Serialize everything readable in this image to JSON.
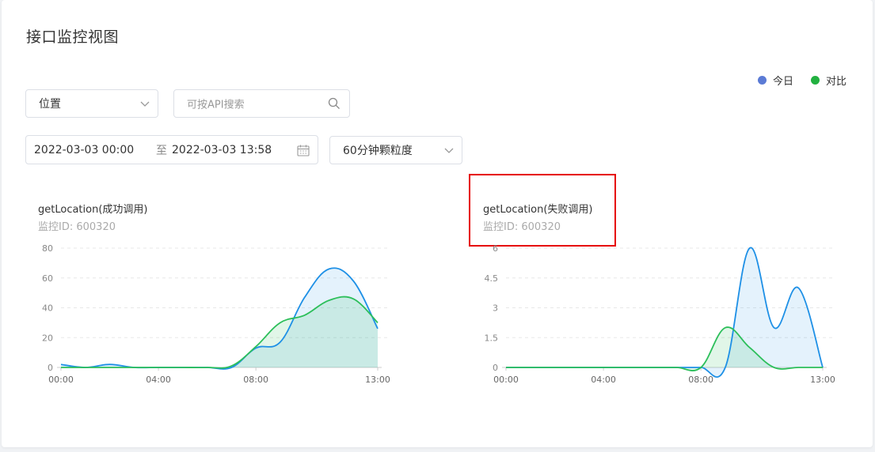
{
  "page": {
    "title": "接口监控视图"
  },
  "legend": [
    {
      "label": "今日",
      "color": "#5b7bd5"
    },
    {
      "label": "对比",
      "color": "#22b140"
    }
  ],
  "filters": {
    "type_select": "位置",
    "search_placeholder": "可按API搜索",
    "date_start": "2022-03-03 00:00",
    "date_sep": "至",
    "date_end": "2022-03-03 13:58",
    "granularity": "60分钟颗粒度"
  },
  "charts": [
    {
      "title": "getLocation(成功调用)",
      "subtitle": "监控ID: 600320"
    },
    {
      "title": "getLocation(失败调用)",
      "subtitle": "监控ID: 600320"
    }
  ],
  "chart_data": [
    {
      "type": "area",
      "title": "getLocation(成功调用)",
      "x_tick_labels": [
        "00:00",
        "04:00",
        "08:00",
        "13:00"
      ],
      "x": [
        0,
        1,
        2,
        3,
        4,
        5,
        6,
        7,
        8,
        9,
        10,
        11,
        12,
        13
      ],
      "ylim": [
        0,
        80
      ],
      "y_ticks": [
        0,
        20,
        40,
        60,
        80
      ],
      "grid": true,
      "series": [
        {
          "name": "今日",
          "color": "#1e90e6",
          "values": [
            2,
            0,
            2,
            0,
            0,
            0,
            0,
            0,
            13,
            17,
            47,
            66,
            58,
            26
          ]
        },
        {
          "name": "对比",
          "color": "#2cbf5a",
          "values": [
            0,
            0,
            0,
            0,
            0,
            0,
            0,
            1,
            14,
            30,
            35,
            45,
            46,
            30
          ]
        }
      ]
    },
    {
      "type": "area",
      "title": "getLocation(失败调用)",
      "x_tick_labels": [
        "00:00",
        "04:00",
        "08:00",
        "13:00"
      ],
      "x": [
        0,
        1,
        2,
        3,
        4,
        5,
        6,
        7,
        8,
        9,
        10,
        11,
        12,
        13
      ],
      "ylim": [
        0,
        6
      ],
      "y_ticks": [
        "0",
        "1.5",
        "3",
        "4.5",
        "6"
      ],
      "grid": true,
      "series": [
        {
          "name": "今日",
          "color": "#1e90e6",
          "values": [
            0,
            0,
            0,
            0,
            0,
            0,
            0,
            0,
            0,
            0,
            6,
            2,
            4,
            0
          ]
        },
        {
          "name": "对比",
          "color": "#2cbf5a",
          "values": [
            0,
            0,
            0,
            0,
            0,
            0,
            0,
            0,
            0,
            2,
            1,
            0,
            0,
            0
          ]
        }
      ]
    }
  ]
}
